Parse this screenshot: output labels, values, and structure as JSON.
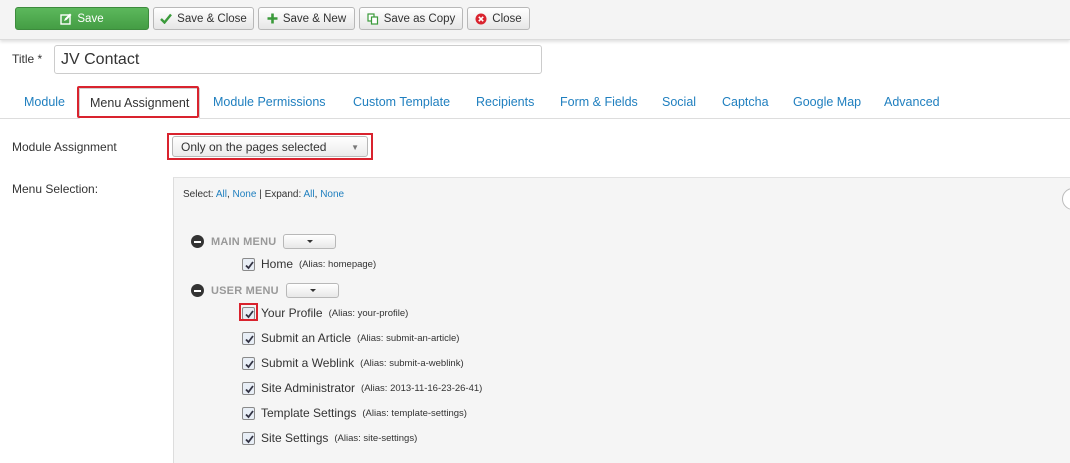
{
  "toolbar": {
    "save_label": "Save",
    "save_close_label": "Save & Close",
    "save_new_label": "Save & New",
    "save_copy_label": "Save as Copy",
    "close_label": "Close"
  },
  "title": {
    "label": "Title *",
    "value": "JV Contact"
  },
  "tabs": [
    {
      "label": "Module"
    },
    {
      "label": "Menu Assignment"
    },
    {
      "label": "Module Permissions"
    },
    {
      "label": "Custom Template"
    },
    {
      "label": "Recipients"
    },
    {
      "label": "Form & Fields"
    },
    {
      "label": "Social"
    },
    {
      "label": "Captcha"
    },
    {
      "label": "Google Map"
    },
    {
      "label": "Advanced"
    }
  ],
  "module_assignment": {
    "label": "Module Assignment",
    "selected": "Only on the pages selected"
  },
  "menu_selection": {
    "label": "Menu Selection:",
    "select_prefix": "Select:",
    "all": "All",
    "comma": ",",
    "none": "None",
    "sep": "|",
    "expand_prefix": "Expand:"
  },
  "main_menu": {
    "title": "MAIN MENU",
    "items": [
      {
        "name": "Home",
        "alias": "(Alias: homepage)",
        "checked": true
      }
    ]
  },
  "user_menu": {
    "title": "USER MENU",
    "items": [
      {
        "name": "Your Profile",
        "alias": "(Alias: your-profile)",
        "checked": true
      },
      {
        "name": "Submit an Article",
        "alias": "(Alias: submit-an-article)",
        "checked": true
      },
      {
        "name": "Submit a Weblink",
        "alias": "(Alias: submit-a-weblink)",
        "checked": true
      },
      {
        "name": "Site Administrator",
        "alias": "(Alias: 2013-11-16-23-26-41)",
        "checked": true
      },
      {
        "name": "Template Settings",
        "alias": "(Alias: template-settings)",
        "checked": true
      },
      {
        "name": "Site Settings",
        "alias": "(Alias: site-settings)",
        "checked": true
      }
    ]
  },
  "colors": {
    "save_green": "#5cb85c",
    "link_blue": "#1f7fbf",
    "highlight_red": "#d9232e"
  },
  "icons": [
    "edit-icon",
    "checkmark-icon",
    "plus-icon",
    "copy-icon",
    "close-circle-icon",
    "minus-circle-icon",
    "caret-down-icon",
    "checkbox-check-icon"
  ]
}
